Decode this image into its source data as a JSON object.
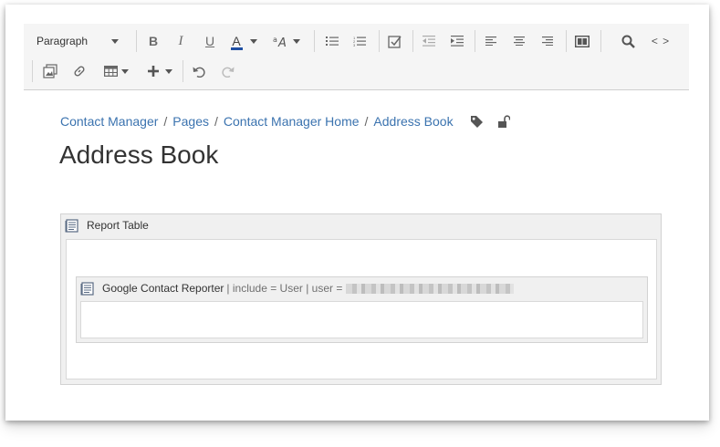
{
  "toolbar": {
    "paragraph_label": "Paragraph",
    "bold": "B",
    "italic": "I",
    "underline": "U",
    "text_color": "A",
    "code_label": "< >"
  },
  "breadcrumb": {
    "items": [
      "Contact Manager",
      "Pages",
      "Contact Manager Home",
      "Address Book"
    ],
    "separator": "/"
  },
  "page": {
    "title": "Address Book"
  },
  "macros": {
    "outer": {
      "name": "Report Table"
    },
    "inner": {
      "name": "Google Contact Reporter",
      "params": "| include = User | user ="
    }
  },
  "colors": {
    "link": "#3b73af",
    "text_color_bar": "#1f4fa3"
  }
}
